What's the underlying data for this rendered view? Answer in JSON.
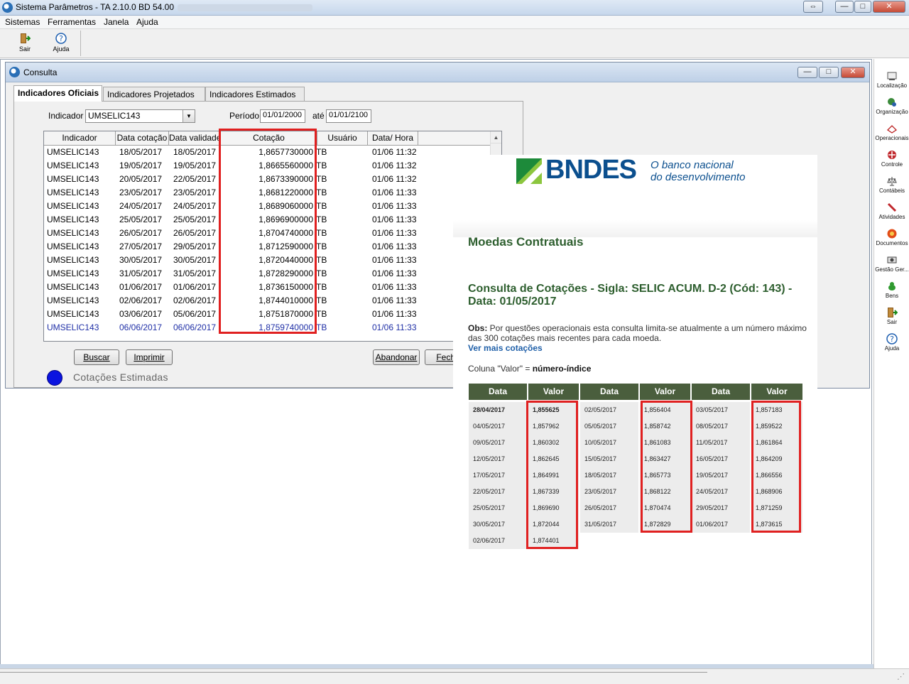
{
  "app": {
    "title": "Sistema Parâmetros  -  TA 2.10.0 BD 54.00",
    "window_controls": {
      "restore": "⇔",
      "minimize": "—",
      "maximize": "□",
      "close": "✕"
    }
  },
  "menu": [
    "Sistemas",
    "Ferramentas",
    "Janela",
    "Ajuda"
  ],
  "toolbar": [
    {
      "label": "Sair",
      "icon": "exit-door-icon"
    },
    {
      "label": "Ajuda",
      "icon": "help-icon"
    }
  ],
  "sidebar": [
    {
      "label": "Localização",
      "icon": "location-icon"
    },
    {
      "label": "Organização",
      "icon": "organization-icon"
    },
    {
      "label": "Operacionais",
      "icon": "operations-icon"
    },
    {
      "label": "Controle",
      "icon": "control-icon"
    },
    {
      "label": "Contábeis",
      "icon": "accounting-icon"
    },
    {
      "label": "Atividades",
      "icon": "activities-icon"
    },
    {
      "label": "Documentos",
      "icon": "documents-icon"
    },
    {
      "label": "Gestão Ger...",
      "icon": "management-icon"
    },
    {
      "label": "Bens",
      "icon": "assets-icon"
    },
    {
      "label": "Sair",
      "icon": "exit-door-icon"
    },
    {
      "label": "Ajuda",
      "icon": "help-icon"
    }
  ],
  "consulta": {
    "title": "Consulta",
    "tabs": [
      "Indicadores Oficiais",
      "Indicadores Projetados",
      "Indicadores Estimados"
    ],
    "indicador_label": "Indicador",
    "indicador_value": "UMSELIC143",
    "periodo_label": "Período",
    "periodo_start": "01/01/2000",
    "ate_label": "até",
    "periodo_end": "01/01/2100",
    "columns": [
      "Indicador",
      "Data cotação",
      "Data validade",
      "Cotação",
      "Usuário",
      "Data/ Hora"
    ],
    "rows": [
      [
        "UMSELIC143",
        "18/05/2017",
        "18/05/2017",
        "1,8657730000",
        "TB",
        "01/06 11:32"
      ],
      [
        "UMSELIC143",
        "19/05/2017",
        "19/05/2017",
        "1,8665560000",
        "TB",
        "01/06 11:32"
      ],
      [
        "UMSELIC143",
        "20/05/2017",
        "22/05/2017",
        "1,8673390000",
        "TB",
        "01/06 11:32"
      ],
      [
        "UMSELIC143",
        "23/05/2017",
        "23/05/2017",
        "1,8681220000",
        "TB",
        "01/06 11:33"
      ],
      [
        "UMSELIC143",
        "24/05/2017",
        "24/05/2017",
        "1,8689060000",
        "TB",
        "01/06 11:33"
      ],
      [
        "UMSELIC143",
        "25/05/2017",
        "25/05/2017",
        "1,8696900000",
        "TB",
        "01/06 11:33"
      ],
      [
        "UMSELIC143",
        "26/05/2017",
        "26/05/2017",
        "1,8704740000",
        "TB",
        "01/06 11:33"
      ],
      [
        "UMSELIC143",
        "27/05/2017",
        "29/05/2017",
        "1,8712590000",
        "TB",
        "01/06 11:33"
      ],
      [
        "UMSELIC143",
        "30/05/2017",
        "30/05/2017",
        "1,8720440000",
        "TB",
        "01/06 11:33"
      ],
      [
        "UMSELIC143",
        "31/05/2017",
        "31/05/2017",
        "1,8728290000",
        "TB",
        "01/06 11:33"
      ],
      [
        "UMSELIC143",
        "01/06/2017",
        "01/06/2017",
        "1,8736150000",
        "TB",
        "01/06 11:33"
      ],
      [
        "UMSELIC143",
        "02/06/2017",
        "02/06/2017",
        "1,8744010000",
        "TB",
        "01/06 11:33"
      ],
      [
        "UMSELIC143",
        "03/06/2017",
        "05/06/2017",
        "1,8751870000",
        "TB",
        "01/06 11:33"
      ],
      [
        "UMSELIC143",
        "06/06/2017",
        "06/06/2017",
        "1,8759740000",
        "TB",
        "01/06 11:33"
      ]
    ],
    "buttons": {
      "buscar": "Buscar",
      "imprimir": "Imprimir",
      "abandonar": "Abandonar",
      "fechar": "Fecha"
    },
    "legend": "Cotações Estimadas",
    "legend_color": "#0b14e0"
  },
  "bndes": {
    "logo_text": "BNDES",
    "tagline_1": "O banco nacional",
    "tagline_2": "do desenvolvimento",
    "brand_color": "#0b4f8e",
    "heading": "Moedas Contratuais",
    "consulta_title": "Consulta de Cotações - Sigla: SELIC ACUM. D-2 (Cód: 143) - Data: 01/05/2017",
    "obs_label": "Obs:",
    "obs_text": " Por questões operacionais esta consulta limita-se atualmente a um número máximo das 300 cotações mais recentes para cada moeda.",
    "more_link": "Ver mais cotações",
    "col_note_prefix": "Coluna \"Valor\" = ",
    "col_note_bold": "número-índice",
    "header_color": "#4a5e3d",
    "table_headers": [
      "Data",
      "Valor",
      "Data",
      "Valor",
      "Data",
      "Valor"
    ],
    "table_rows": [
      [
        "28/04/2017",
        "1,855625",
        "02/05/2017",
        "1,856404",
        "03/05/2017",
        "1,857183"
      ],
      [
        "04/05/2017",
        "1,857962",
        "05/05/2017",
        "1,858742",
        "08/05/2017",
        "1,859522"
      ],
      [
        "09/05/2017",
        "1,860302",
        "10/05/2017",
        "1,861083",
        "11/05/2017",
        "1,861864"
      ],
      [
        "12/05/2017",
        "1,862645",
        "15/05/2017",
        "1,863427",
        "16/05/2017",
        "1,864209"
      ],
      [
        "17/05/2017",
        "1,864991",
        "18/05/2017",
        "1,865773",
        "19/05/2017",
        "1,866556"
      ],
      [
        "22/05/2017",
        "1,867339",
        "23/05/2017",
        "1,868122",
        "24/05/2017",
        "1,868906"
      ],
      [
        "25/05/2017",
        "1,869690",
        "26/05/2017",
        "1,870474",
        "29/05/2017",
        "1,871259"
      ],
      [
        "30/05/2017",
        "1,872044",
        "31/05/2017",
        "1,872829",
        "01/06/2017",
        "1,873615"
      ],
      [
        "02/06/2017",
        "1,874401",
        "",
        "",
        "",
        ""
      ]
    ]
  },
  "highlight_color": "#e02020"
}
